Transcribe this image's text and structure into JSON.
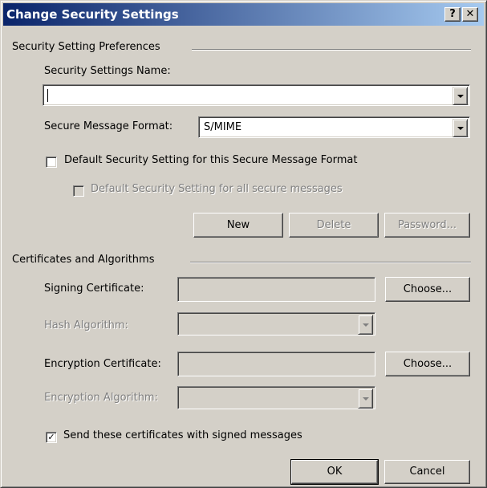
{
  "window": {
    "title": "Change Security Settings",
    "help_label": "?",
    "close_label": "✕"
  },
  "preferences": {
    "group_label": "Security Setting Preferences",
    "name_label": "Security Settings Name:",
    "name_value": "",
    "format_label": "Secure Message Format:",
    "format_value": "S/MIME",
    "default_format_label": "Default Security Setting for this Secure Message Format",
    "default_format_checked": false,
    "default_all_label": "Default Security Setting for all secure messages",
    "default_all_checked": false,
    "new_button": "New",
    "delete_button": "Delete",
    "password_button": "Password..."
  },
  "certificates": {
    "group_label": "Certificates and Algorithms",
    "signing_label": "Signing Certificate:",
    "signing_value": "",
    "choose_signing_button": "Choose...",
    "hash_label": "Hash Algorithm:",
    "hash_value": "",
    "encryption_label": "Encryption Certificate:",
    "encryption_value": "",
    "choose_encryption_button": "Choose...",
    "enc_algorithm_label": "Encryption Algorithm:",
    "enc_algorithm_value": "",
    "send_certs_label": "Send these certificates with signed messages",
    "send_certs_checked": true
  },
  "footer": {
    "ok_button": "OK",
    "cancel_button": "Cancel"
  },
  "colors": {
    "titlebar_start": "#0a246a",
    "titlebar_end": "#a6caf0",
    "face": "#d4d0c8"
  }
}
